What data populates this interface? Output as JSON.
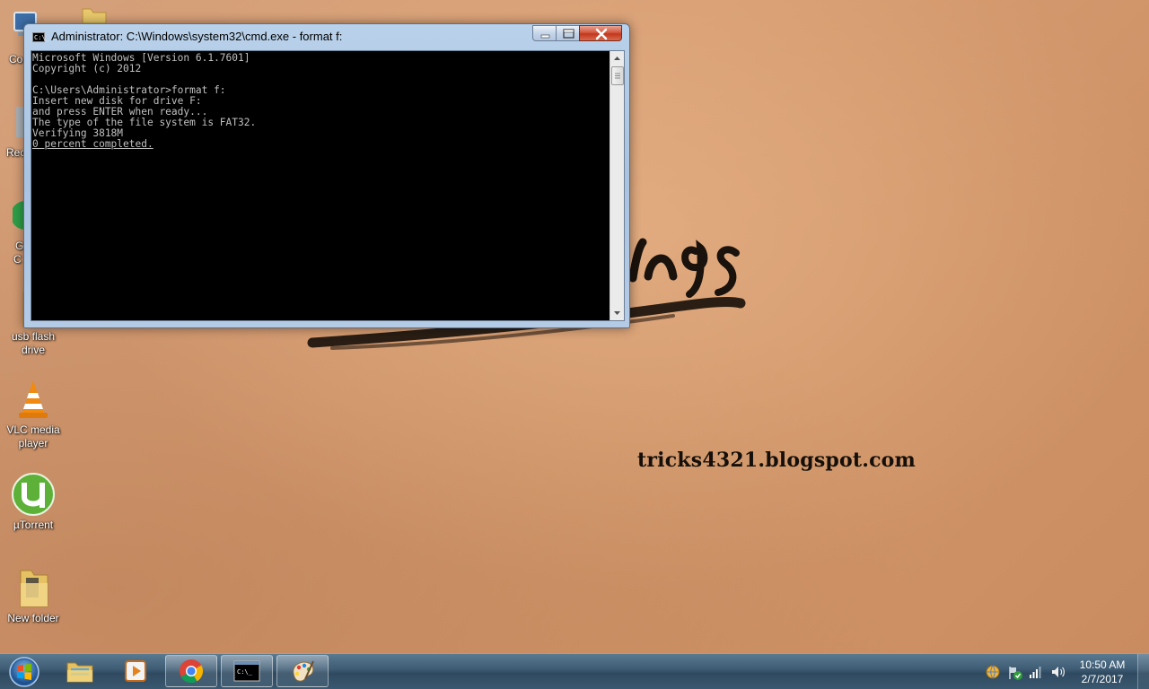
{
  "window": {
    "title": "Administrator: C:\\Windows\\system32\\cmd.exe - format  f:",
    "console_lines": [
      "Microsoft Windows [Version 6.1.7601]",
      "Copyright (c) 2012",
      "",
      "C:\\Users\\Administrator>format f:",
      "Insert new disk for drive F:",
      "and press ENTER when ready...",
      "The type of the file system is FAT32.",
      "Verifying 3818M",
      "0 percent completed."
    ]
  },
  "desktop": {
    "watermark": "tricks4321.blogspot.com",
    "partial_labels": [
      "Co",
      "Rec",
      "G",
      "C"
    ],
    "icons": [
      {
        "label_line1": "usb flash",
        "label_line2": "drive",
        "icon": "folder-icon"
      },
      {
        "label_line1": "VLC media",
        "label_line2": "player",
        "icon": "vlc-cone-icon"
      },
      {
        "label_line1": "µTorrent",
        "label_line2": "",
        "icon": "utorrent-icon"
      },
      {
        "label_line1": "New folder",
        "label_line2": "",
        "icon": "folder-icon"
      }
    ]
  },
  "taskbar": {
    "items": [
      "windows-explorer-icon",
      "media-player-icon",
      "chrome-icon",
      "cmd-icon",
      "paint-icon"
    ],
    "clock_time": "10:50 AM",
    "clock_date": "2/7/2017"
  },
  "colors": {
    "console_bg": "#000000",
    "console_fg": "#c0c0c0",
    "close_button": "#c7412a",
    "taskbar": "#3d5a72"
  }
}
